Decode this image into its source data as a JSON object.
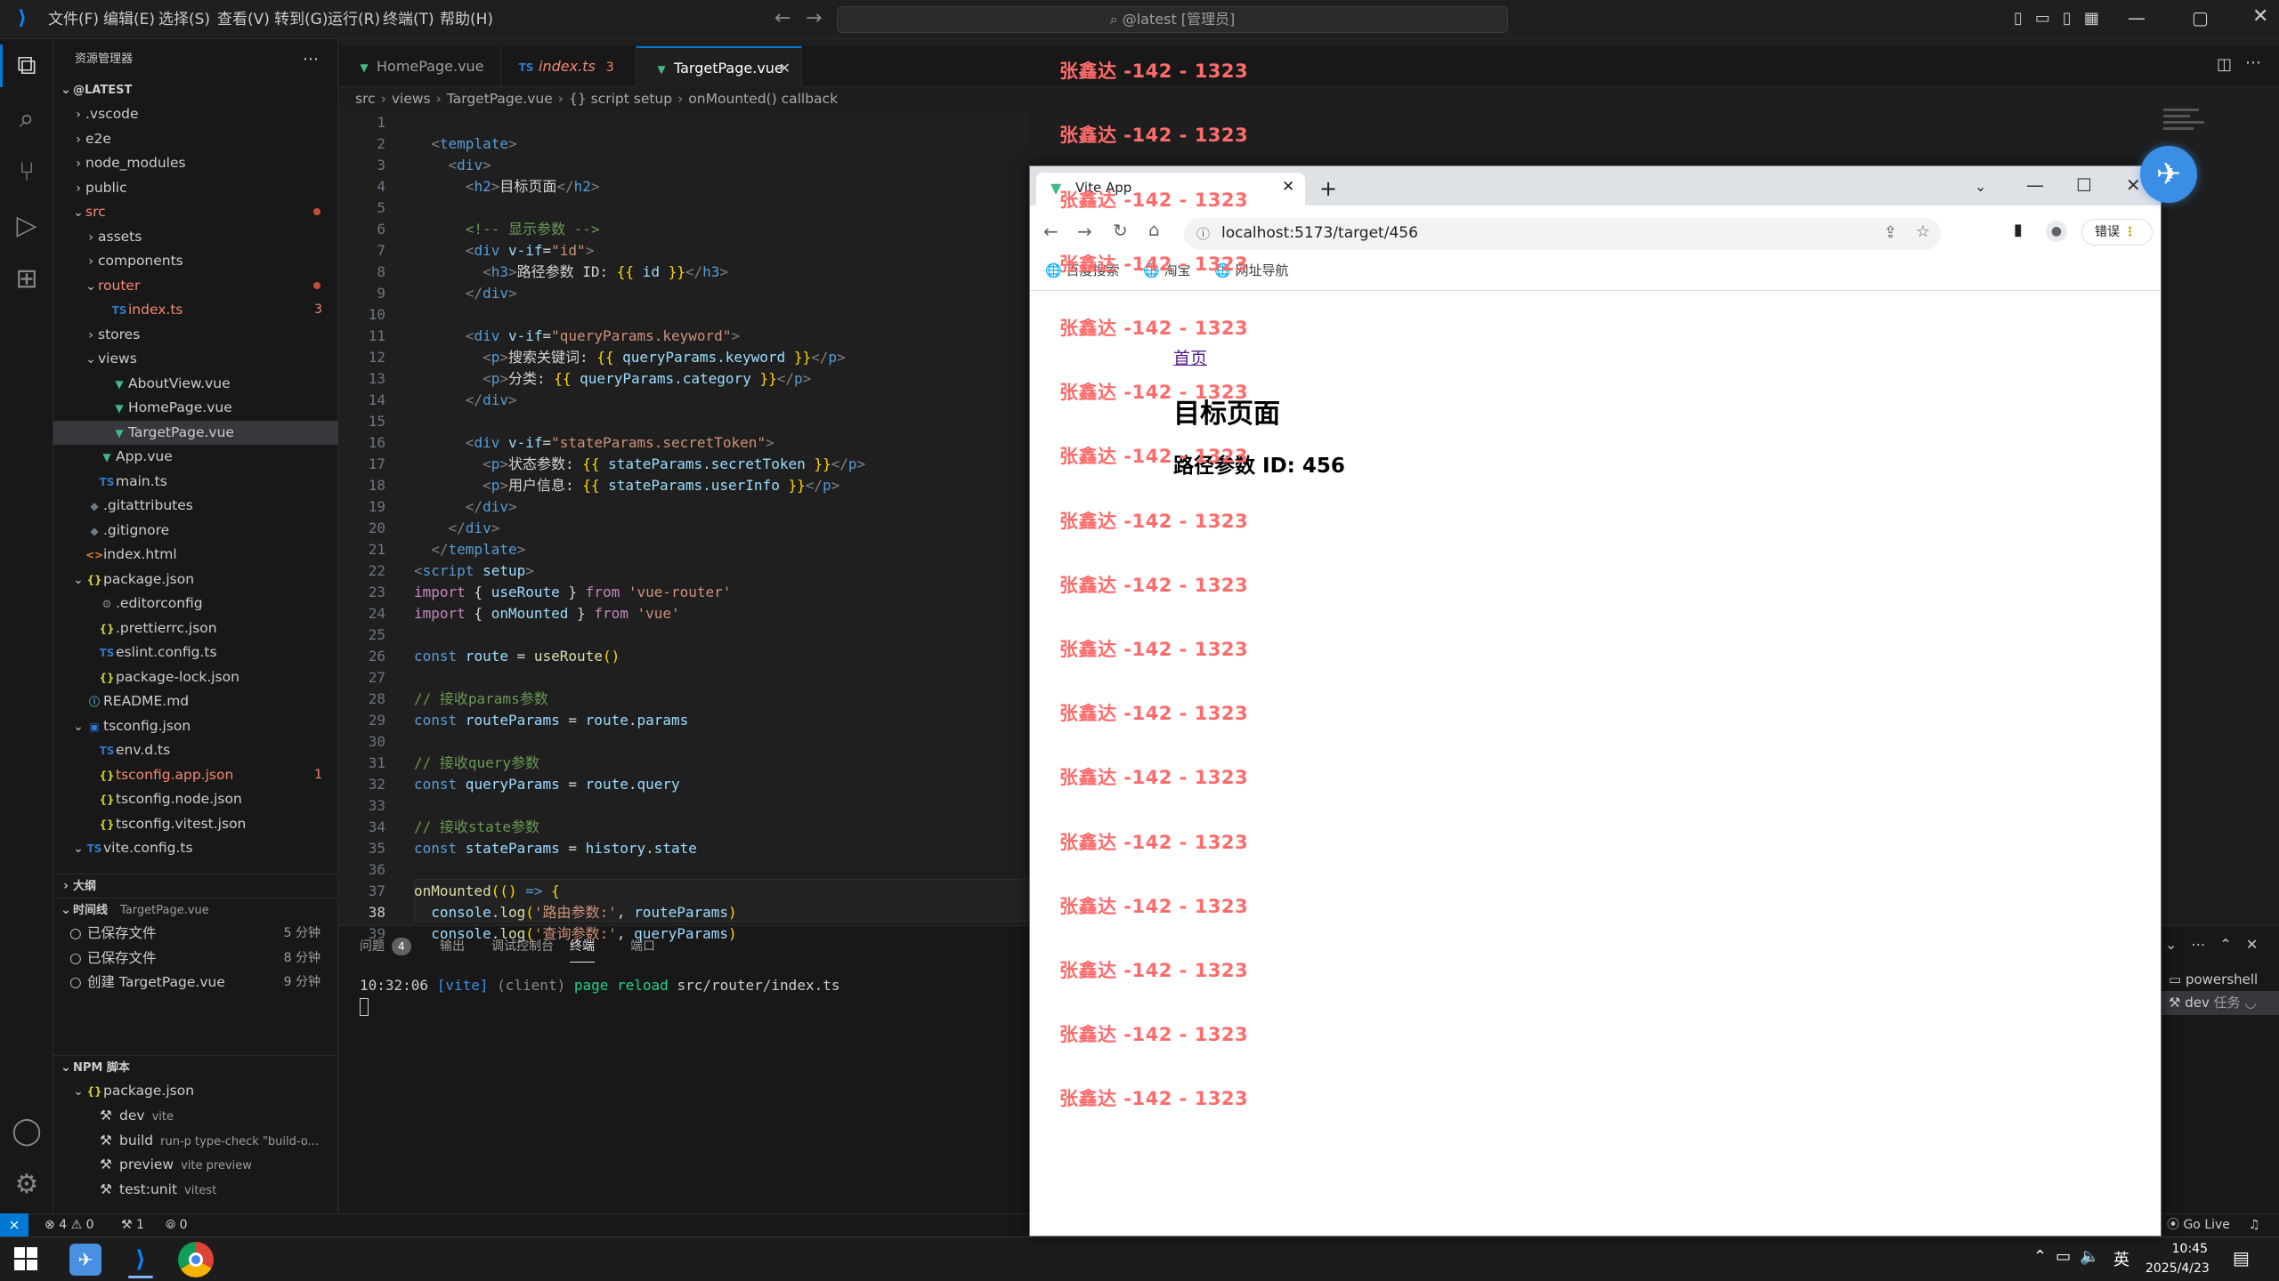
{
  "menu": [
    "文件(F)",
    "编辑(E)",
    "选择(S)",
    "查看(V)",
    "转到(G)",
    "运行(R)",
    "终端(T)",
    "帮助(H)"
  ],
  "command_center": "@latest [管理员]",
  "explorer": {
    "title": "资源管理器",
    "root": "@LATEST",
    "rows": [
      {
        "name": ".vscode",
        "indent": 1,
        "type": "folder",
        "open": false
      },
      {
        "name": "e2e",
        "indent": 1,
        "type": "folder",
        "open": false
      },
      {
        "name": "node_modules",
        "indent": 1,
        "type": "folder",
        "open": false
      },
      {
        "name": "public",
        "indent": 1,
        "type": "folder",
        "open": false
      },
      {
        "name": "src",
        "indent": 1,
        "type": "folder",
        "open": true,
        "color": "#f48771",
        "dot": true
      },
      {
        "name": "assets",
        "indent": 2,
        "type": "folder",
        "open": false
      },
      {
        "name": "components",
        "indent": 2,
        "type": "folder",
        "open": false
      },
      {
        "name": "router",
        "indent": 2,
        "type": "folder",
        "open": true,
        "color": "#f48771",
        "dot": true
      },
      {
        "name": "index.ts",
        "indent": 3,
        "type": "ts",
        "color": "#f48771",
        "badge": "3"
      },
      {
        "name": "stores",
        "indent": 2,
        "type": "folder",
        "open": false
      },
      {
        "name": "views",
        "indent": 2,
        "type": "folder",
        "open": true
      },
      {
        "name": "AboutView.vue",
        "indent": 3,
        "type": "vue"
      },
      {
        "name": "HomePage.vue",
        "indent": 3,
        "type": "vue"
      },
      {
        "name": "TargetPage.vue",
        "indent": 3,
        "type": "vue",
        "selected": true
      },
      {
        "name": "App.vue",
        "indent": 2,
        "type": "vue"
      },
      {
        "name": "main.ts",
        "indent": 2,
        "type": "ts"
      },
      {
        "name": ".gitattributes",
        "indent": 1,
        "type": "git"
      },
      {
        "name": ".gitignore",
        "indent": 1,
        "type": "git"
      },
      {
        "name": "index.html",
        "indent": 1,
        "type": "html"
      },
      {
        "name": "package.json",
        "indent": 1,
        "type": "json",
        "open": true,
        "nest": true
      },
      {
        "name": ".editorconfig",
        "indent": 2,
        "type": "gear"
      },
      {
        "name": ".prettierrc.json",
        "indent": 2,
        "type": "json"
      },
      {
        "name": "eslint.config.ts",
        "indent": 2,
        "type": "ts"
      },
      {
        "name": "package-lock.json",
        "indent": 2,
        "type": "json"
      },
      {
        "name": "README.md",
        "indent": 1,
        "type": "info"
      },
      {
        "name": "tsconfig.json",
        "indent": 1,
        "type": "tsjson",
        "open": true,
        "nest": true
      },
      {
        "name": "env.d.ts",
        "indent": 2,
        "type": "ts"
      },
      {
        "name": "tsconfig.app.json",
        "indent": 2,
        "type": "json",
        "color": "#f48771",
        "badge": "1"
      },
      {
        "name": "tsconfig.node.json",
        "indent": 2,
        "type": "json"
      },
      {
        "name": "tsconfig.vitest.json",
        "indent": 2,
        "type": "json"
      },
      {
        "name": "vite.config.ts",
        "indent": 1,
        "type": "ts",
        "open": true,
        "nest": true
      }
    ],
    "outline": "大纲",
    "timeline": {
      "title": "时间线",
      "file": "TargetPage.vue",
      "items": [
        {
          "label": "已保存文件",
          "time": "5 分钟"
        },
        {
          "label": "已保存文件",
          "time": "8 分钟"
        },
        {
          "label": "创建 TargetPage.vue",
          "time": "9 分钟"
        }
      ]
    },
    "npm": {
      "title": "NPM 脚本",
      "pkg": "package.json",
      "scripts": [
        {
          "name": "dev",
          "cmd": "vite"
        },
        {
          "name": "build",
          "cmd": "run-p type-check \"build-o..."
        },
        {
          "name": "preview",
          "cmd": "vite preview"
        },
        {
          "name": "test:unit",
          "cmd": "vitest"
        }
      ]
    }
  },
  "tabs": [
    {
      "label": "HomePage.vue",
      "type": "vue"
    },
    {
      "label": "index.ts",
      "type": "ts",
      "badge": "3",
      "italic": true
    },
    {
      "label": "TargetPage.vue",
      "type": "vue",
      "active": true
    }
  ],
  "breadcrumb": [
    "src",
    "views",
    "TargetPage.vue",
    "{} script setup",
    "onMounted() callback"
  ],
  "code_lines": [
    [],
    [
      [
        "ang",
        "  <"
      ],
      [
        "tag",
        "template"
      ],
      [
        "ang",
        ">"
      ]
    ],
    [
      [
        "ang",
        "    <"
      ],
      [
        "tag",
        "div"
      ],
      [
        "ang",
        ">"
      ]
    ],
    [
      [
        "ang",
        "      <"
      ],
      [
        "tag",
        "h2"
      ],
      [
        "ang",
        ">"
      ],
      [
        "txt",
        "目标页面"
      ],
      [
        "ang",
        "</"
      ],
      [
        "tag",
        "h2"
      ],
      [
        "ang",
        ">"
      ]
    ],
    [],
    [
      [
        "cm",
        "      <!-- 显示参数 -->"
      ]
    ],
    [
      [
        "ang",
        "      <"
      ],
      [
        "tag",
        "div"
      ],
      [
        "attr",
        " v-if"
      ],
      [
        "txt",
        "="
      ],
      [
        "str",
        "\"id\""
      ],
      [
        "ang",
        ">"
      ]
    ],
    [
      [
        "ang",
        "        <"
      ],
      [
        "tag",
        "h3"
      ],
      [
        "ang",
        ">"
      ],
      [
        "txt",
        "路径参数 ID: "
      ],
      [
        "br",
        "{{"
      ],
      [
        "var",
        " id "
      ],
      [
        "br",
        "}}"
      ],
      [
        "ang",
        "</"
      ],
      [
        "tag",
        "h3"
      ],
      [
        "ang",
        ">"
      ]
    ],
    [
      [
        "ang",
        "      </"
      ],
      [
        "tag",
        "div"
      ],
      [
        "ang",
        ">"
      ]
    ],
    [],
    [
      [
        "ang",
        "      <"
      ],
      [
        "tag",
        "div"
      ],
      [
        "attr",
        " v-if"
      ],
      [
        "txt",
        "="
      ],
      [
        "str",
        "\"queryParams.keyword\""
      ],
      [
        "ang",
        ">"
      ]
    ],
    [
      [
        "ang",
        "        <"
      ],
      [
        "tag",
        "p"
      ],
      [
        "ang",
        ">"
      ],
      [
        "txt",
        "搜索关键词: "
      ],
      [
        "br",
        "{{"
      ],
      [
        "var",
        " queryParams.keyword "
      ],
      [
        "br",
        "}}"
      ],
      [
        "ang",
        "</"
      ],
      [
        "tag",
        "p"
      ],
      [
        "ang",
        ">"
      ]
    ],
    [
      [
        "ang",
        "        <"
      ],
      [
        "tag",
        "p"
      ],
      [
        "ang",
        ">"
      ],
      [
        "txt",
        "分类: "
      ],
      [
        "br",
        "{{"
      ],
      [
        "var",
        " queryParams.category "
      ],
      [
        "br",
        "}}"
      ],
      [
        "ang",
        "</"
      ],
      [
        "tag",
        "p"
      ],
      [
        "ang",
        ">"
      ]
    ],
    [
      [
        "ang",
        "      </"
      ],
      [
        "tag",
        "div"
      ],
      [
        "ang",
        ">"
      ]
    ],
    [],
    [
      [
        "ang",
        "      <"
      ],
      [
        "tag",
        "div"
      ],
      [
        "attr",
        " v-if"
      ],
      [
        "txt",
        "="
      ],
      [
        "str",
        "\"stateParams.secretToken\""
      ],
      [
        "ang",
        ">"
      ]
    ],
    [
      [
        "ang",
        "        <"
      ],
      [
        "tag",
        "p"
      ],
      [
        "ang",
        ">"
      ],
      [
        "txt",
        "状态参数: "
      ],
      [
        "br",
        "{{"
      ],
      [
        "var",
        " stateParams.secretToken "
      ],
      [
        "br",
        "}}"
      ],
      [
        "ang",
        "</"
      ],
      [
        "tag",
        "p"
      ],
      [
        "ang",
        ">"
      ]
    ],
    [
      [
        "ang",
        "        <"
      ],
      [
        "tag",
        "p"
      ],
      [
        "ang",
        ">"
      ],
      [
        "txt",
        "用户信息: "
      ],
      [
        "br",
        "{{"
      ],
      [
        "var",
        " stateParams.userInfo "
      ],
      [
        "br",
        "}}"
      ],
      [
        "ang",
        "</"
      ],
      [
        "tag",
        "p"
      ],
      [
        "ang",
        ">"
      ]
    ],
    [
      [
        "ang",
        "      </"
      ],
      [
        "tag",
        "div"
      ],
      [
        "ang",
        ">"
      ]
    ],
    [
      [
        "ang",
        "    </"
      ],
      [
        "tag",
        "div"
      ],
      [
        "ang",
        ">"
      ]
    ],
    [
      [
        "ang",
        "  </"
      ],
      [
        "tag",
        "template"
      ],
      [
        "ang",
        ">"
      ]
    ],
    [
      [
        "ang",
        "<"
      ],
      [
        "tag",
        "script"
      ],
      [
        "attr",
        " setup"
      ],
      [
        "ang",
        ">"
      ]
    ],
    [
      [
        "kw2",
        "import"
      ],
      [
        "txt",
        " { "
      ],
      [
        "var",
        "useRoute"
      ],
      [
        "txt",
        " } "
      ],
      [
        "kw2",
        "from"
      ],
      [
        "str",
        " 'vue-router'"
      ]
    ],
    [
      [
        "kw2",
        "import"
      ],
      [
        "txt",
        " { "
      ],
      [
        "var",
        "onMounted"
      ],
      [
        "txt",
        " } "
      ],
      [
        "kw2",
        "from"
      ],
      [
        "str",
        " 'vue'"
      ]
    ],
    [],
    [
      [
        "kw",
        "const"
      ],
      [
        "var",
        " route"
      ],
      [
        "txt",
        " = "
      ],
      [
        "fn",
        "useRoute"
      ],
      [
        "br",
        "()"
      ]
    ],
    [],
    [
      [
        "cm",
        "// 接收params参数"
      ]
    ],
    [
      [
        "kw",
        "const"
      ],
      [
        "var",
        " routeParams"
      ],
      [
        "txt",
        " = "
      ],
      [
        "var",
        "route"
      ],
      [
        "txt",
        "."
      ],
      [
        "var",
        "params"
      ]
    ],
    [],
    [
      [
        "cm",
        "// 接收query参数"
      ]
    ],
    [
      [
        "kw",
        "const"
      ],
      [
        "var",
        " queryParams"
      ],
      [
        "txt",
        " = "
      ],
      [
        "var",
        "route"
      ],
      [
        "txt",
        "."
      ],
      [
        "var",
        "query"
      ]
    ],
    [],
    [
      [
        "cm",
        "// 接收state参数"
      ]
    ],
    [
      [
        "kw",
        "const"
      ],
      [
        "var",
        " stateParams"
      ],
      [
        "txt",
        " = "
      ],
      [
        "var",
        "history"
      ],
      [
        "txt",
        "."
      ],
      [
        "var",
        "state"
      ]
    ],
    [],
    [
      [
        "fn",
        "onMounted"
      ],
      [
        "br",
        "(("
      ],
      [
        "br",
        ")"
      ],
      [
        "kw",
        " =>"
      ],
      [
        "br",
        " {"
      ]
    ],
    [
      [
        "var",
        "  console"
      ],
      [
        "txt",
        "."
      ],
      [
        "fn",
        "log"
      ],
      [
        "br",
        "("
      ],
      [
        "str",
        "'路由参数:'"
      ],
      [
        "txt",
        ", "
      ],
      [
        "var",
        "routeParams"
      ],
      [
        "br",
        ")"
      ]
    ],
    [
      [
        "var",
        "  console"
      ],
      [
        "txt",
        "."
      ],
      [
        "fn",
        "log"
      ],
      [
        "br",
        "("
      ],
      [
        "str",
        "'查询参数:'"
      ],
      [
        "txt",
        ", "
      ],
      [
        "var",
        "queryParams"
      ],
      [
        "br",
        ")"
      ]
    ]
  ],
  "panel": {
    "tabs": [
      "问题",
      "输出",
      "调试控制台",
      "终端",
      "端口"
    ],
    "problems_count": "4",
    "active": "终端",
    "terminal_line": {
      "time": "10:32:06",
      "vite": "[vite]",
      "client": "(client)",
      "msg": "page reload",
      "path": "src/router/index.ts"
    },
    "terminals": [
      {
        "label": "powershell"
      },
      {
        "label": "dev",
        "sub": "任务"
      }
    ]
  },
  "status": {
    "errors": "4",
    "warnings": "0",
    "ports": "1",
    "signal": "0",
    "golive": "Go Live"
  },
  "browser": {
    "tab_title": "Vite App",
    "url": "localhost:5173/target/456",
    "bookmarks": [
      "百度搜索",
      "淘宝",
      "网址导航"
    ],
    "profile": "错误",
    "page": {
      "link": "首页",
      "h2": "目标页面",
      "h3": "路径参数 ID: 456"
    },
    "watermark": "张鑫达 -142 - 1323"
  },
  "taskbar": {
    "time": "10:45",
    "date": "2025/4/23",
    "ime": "英"
  },
  "colors": {
    "accent": "#0078d4",
    "watermark": "#ff6b6b",
    "error": "#f48771",
    "vue": "#42b883",
    "ts": "#3178c6",
    "json": "#cbcb41"
  }
}
